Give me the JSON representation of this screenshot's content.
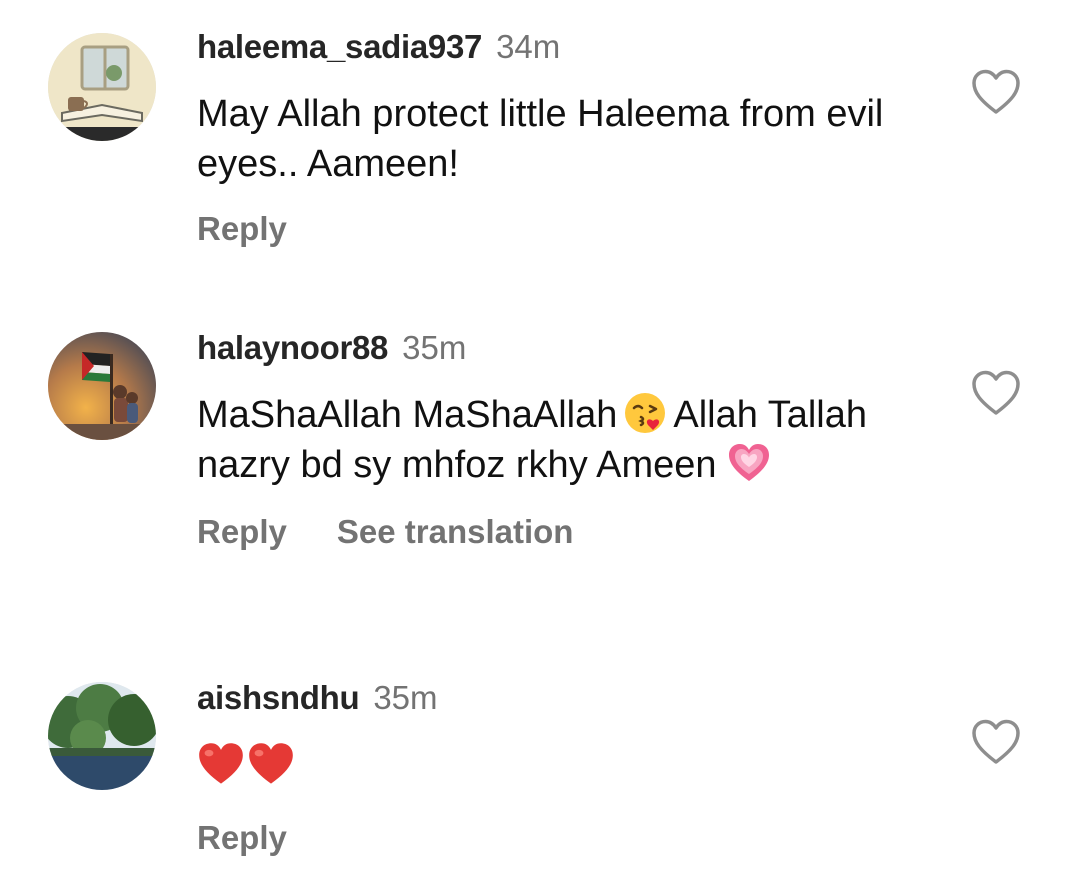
{
  "comments": [
    {
      "username": "haleema_sadia937",
      "time": "34m",
      "text": "May Allah protect little Haleema from evil eyes.. Aameen!",
      "actions": [
        "Reply"
      ],
      "avatar_icon": "teacup-book-window-avatar",
      "like_icon": "heart-outline-icon"
    },
    {
      "username": "halaynoor88",
      "time": "35m",
      "text_part1": "MaShaAllah  MaShaAllah",
      "emoji1": "kissing-face-emoji",
      "text_part2": "Allah Tallah nazry bd sy mhfoz rkhy Ameen",
      "emoji2": "pink-heart-emoji",
      "actions": [
        "Reply",
        "See translation"
      ],
      "avatar_icon": "flag-children-avatar",
      "like_icon": "heart-outline-icon"
    },
    {
      "username": "aishsndhu",
      "time": "35m",
      "emojis": [
        "red-heart-emoji",
        "red-heart-emoji"
      ],
      "actions": [
        "Reply"
      ],
      "avatar_icon": "trees-sky-avatar",
      "like_icon": "heart-outline-icon"
    }
  ],
  "colors": {
    "username": "#262626",
    "secondary": "#737373",
    "text": "#111111",
    "icon": "#8e8e8e"
  }
}
